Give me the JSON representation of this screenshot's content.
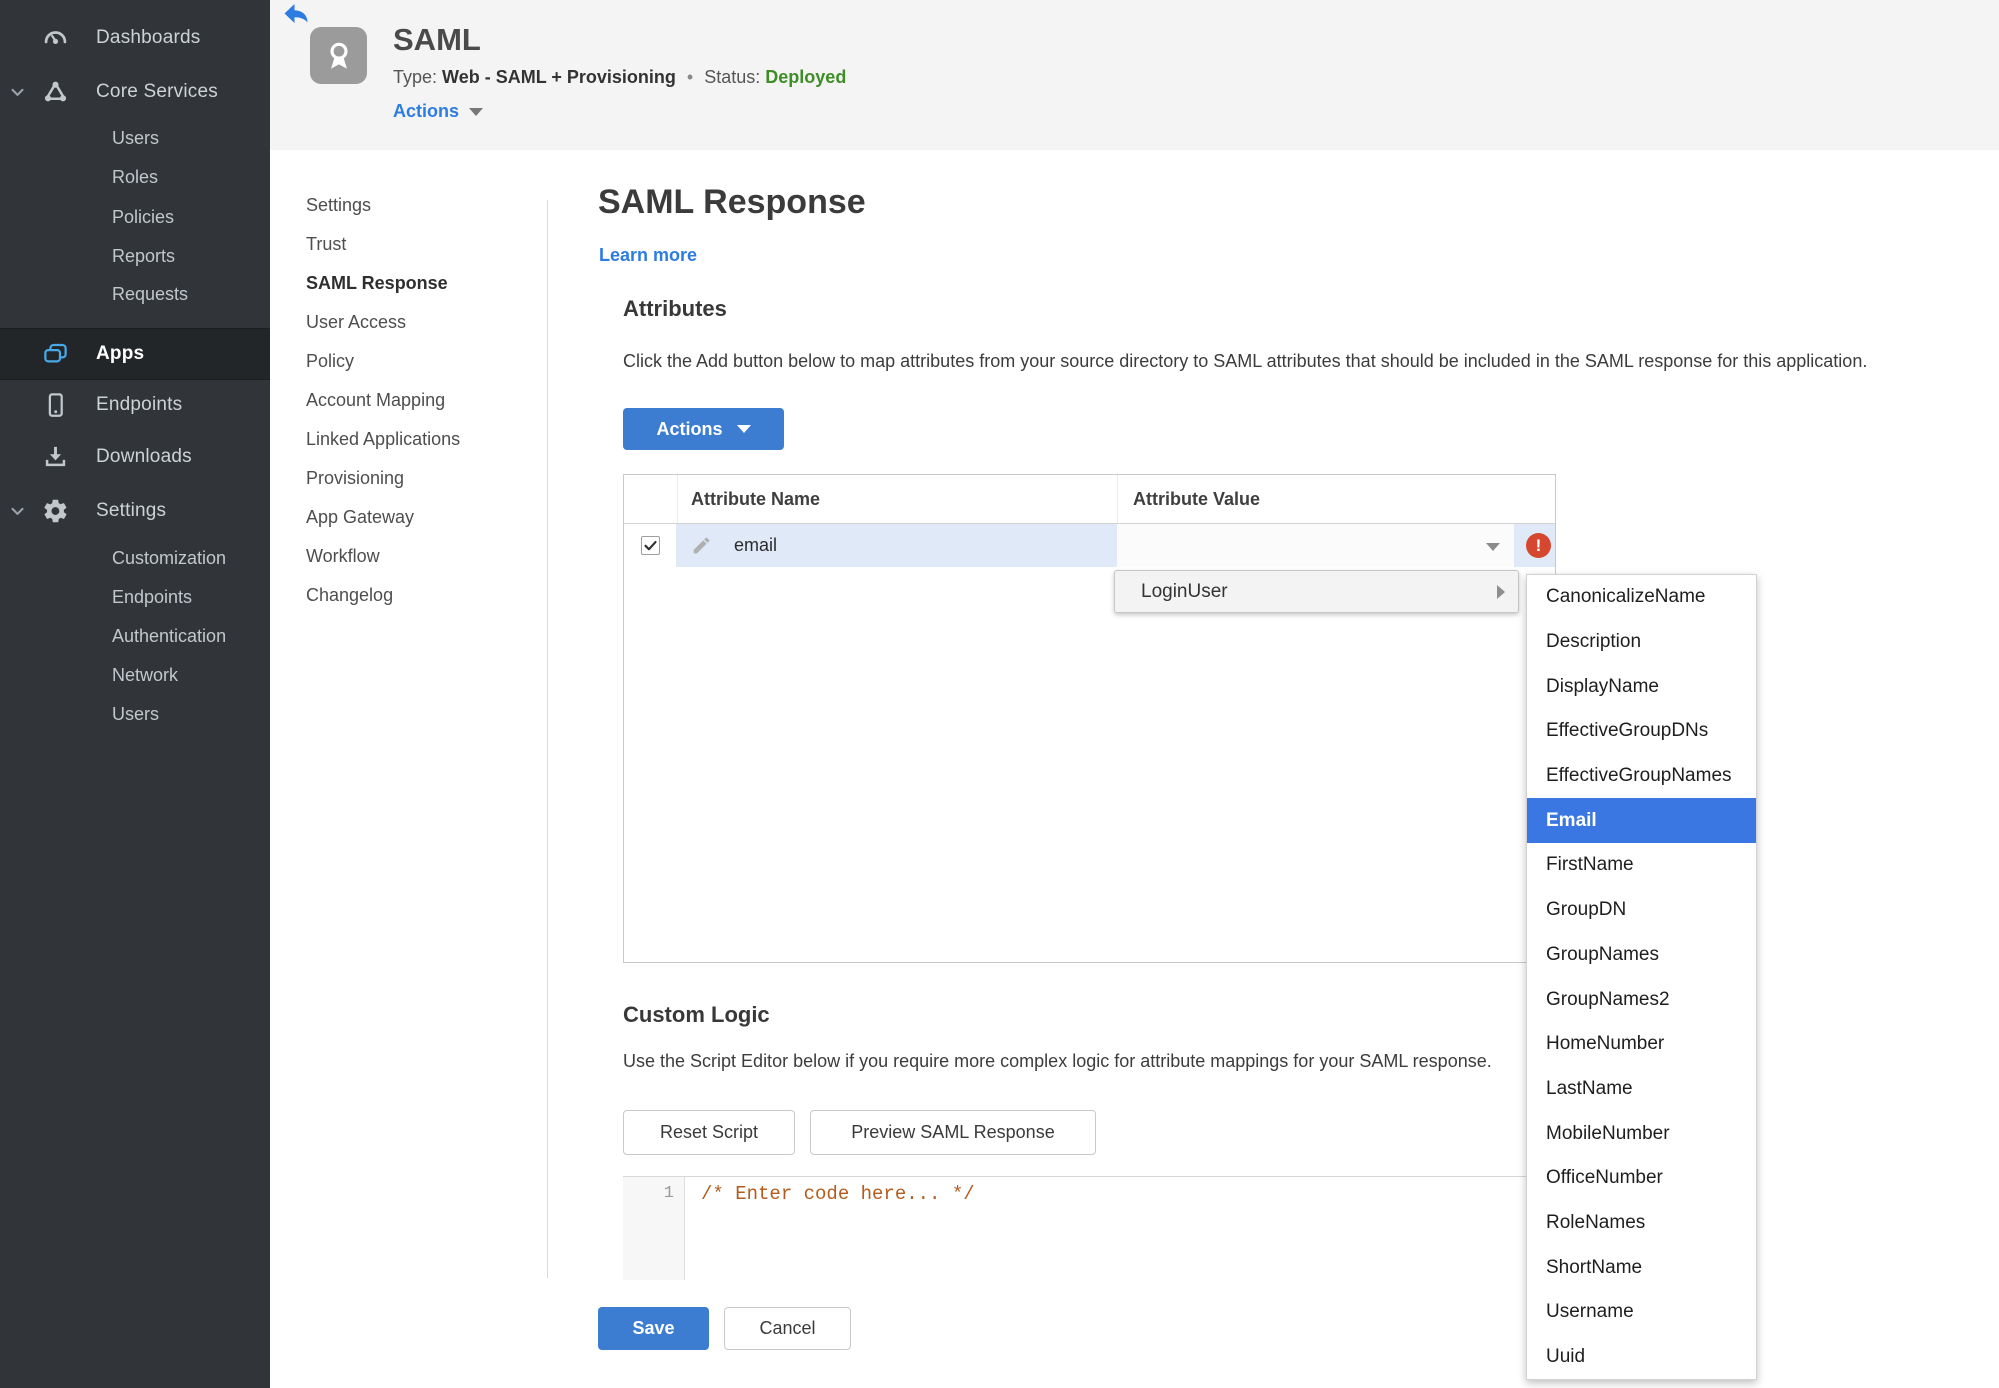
{
  "colors": {
    "sidebar_bg": "#313539",
    "sidebar_active_bg": "#232629",
    "header_bg": "#f4f4f5",
    "accent_blue": "#2d7ce2",
    "button_blue": "#3c7dd2",
    "status_green": "#3e8e26",
    "row_highlight": "#dfe9f7",
    "selected_menu_blue": "#3b77e2",
    "error_red": "#d5472e",
    "code_comment_orange": "#b35c1e"
  },
  "sidebar": {
    "items": [
      {
        "label": "Dashboards"
      },
      {
        "label": "Core Services"
      },
      {
        "label": "Users"
      },
      {
        "label": "Roles"
      },
      {
        "label": "Policies"
      },
      {
        "label": "Reports"
      },
      {
        "label": "Requests"
      },
      {
        "label": "Apps"
      },
      {
        "label": "Endpoints"
      },
      {
        "label": "Downloads"
      },
      {
        "label": "Settings"
      },
      {
        "label": "Customization"
      },
      {
        "label": "Endpoints"
      },
      {
        "label": "Authentication"
      },
      {
        "label": "Network"
      },
      {
        "label": "Users"
      }
    ]
  },
  "header": {
    "title": "SAML",
    "type_label": "Type:",
    "type_value": "Web - SAML + Provisioning",
    "separator": "•",
    "status_label": "Status:",
    "status_value": "Deployed",
    "actions_label": "Actions"
  },
  "subnav": {
    "items": [
      {
        "label": "Settings"
      },
      {
        "label": "Trust"
      },
      {
        "label": "SAML Response"
      },
      {
        "label": "User Access"
      },
      {
        "label": "Policy"
      },
      {
        "label": "Account Mapping"
      },
      {
        "label": "Linked Applications"
      },
      {
        "label": "Provisioning"
      },
      {
        "label": "App Gateway"
      },
      {
        "label": "Workflow"
      },
      {
        "label": "Changelog"
      }
    ]
  },
  "main": {
    "title": "SAML Response",
    "learn_more_label": "Learn more",
    "attributes": {
      "heading": "Attributes",
      "description": "Click the Add button below to map attributes from your source directory to SAML attributes that should be included in the SAML response for this application.",
      "actions_button_label": "Actions",
      "error_glyph": "!",
      "table": {
        "columns": [
          {
            "label": "Attribute Name"
          },
          {
            "label": "Attribute Value"
          }
        ],
        "rows": [
          {
            "checked": true,
            "name": "email",
            "value": "",
            "error": true
          }
        ]
      }
    },
    "value_menu": {
      "root_label": "LoginUser",
      "selected": "Email",
      "items": [
        {
          "label": "CanonicalizeName"
        },
        {
          "label": "Description"
        },
        {
          "label": "DisplayName"
        },
        {
          "label": "EffectiveGroupDNs"
        },
        {
          "label": "EffectiveGroupNames"
        },
        {
          "label": "Email"
        },
        {
          "label": "FirstName"
        },
        {
          "label": "GroupDN"
        },
        {
          "label": "GroupNames"
        },
        {
          "label": "GroupNames2"
        },
        {
          "label": "HomeNumber"
        },
        {
          "label": "LastName"
        },
        {
          "label": "MobileNumber"
        },
        {
          "label": "OfficeNumber"
        },
        {
          "label": "RoleNames"
        },
        {
          "label": "ShortName"
        },
        {
          "label": "Username"
        },
        {
          "label": "Uuid"
        }
      ]
    },
    "custom_logic": {
      "heading": "Custom Logic",
      "description": "Use the Script Editor below if you require more complex logic for attribute mappings for your SAML response.",
      "reset_button_label": "Reset Script",
      "preview_button_label": "Preview SAML Response",
      "editor": {
        "line_number": "1",
        "code": "/* Enter code here... */"
      }
    },
    "save_button_label": "Save",
    "cancel_button_label": "Cancel"
  }
}
